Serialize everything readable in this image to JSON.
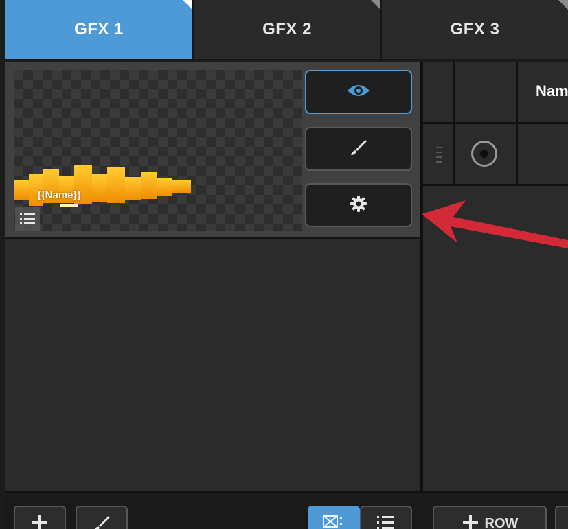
{
  "tabs": [
    {
      "label": "GFX 1",
      "active": true
    },
    {
      "label": "GFX 2",
      "active": false
    },
    {
      "label": "GFX 3",
      "active": false
    }
  ],
  "graphic": {
    "overlay_text": "{{Name}}"
  },
  "controls": {
    "preview_icon": "eye-icon",
    "edit_icon": "brush-icon",
    "settings_icon": "gear-icon"
  },
  "table": {
    "name_header": "Nam"
  },
  "toolbar": {
    "add_icon": "plus-icon",
    "edit_icon": "brush-icon",
    "thumbnail_view_icon": "grid-view-icon",
    "list_view_icon": "list-view-icon",
    "add_row_label": "ROW"
  },
  "colors": {
    "accent": "#4d9ad6",
    "annotation_arrow": "#d42a38",
    "graphic_orange": "#f5a623"
  }
}
